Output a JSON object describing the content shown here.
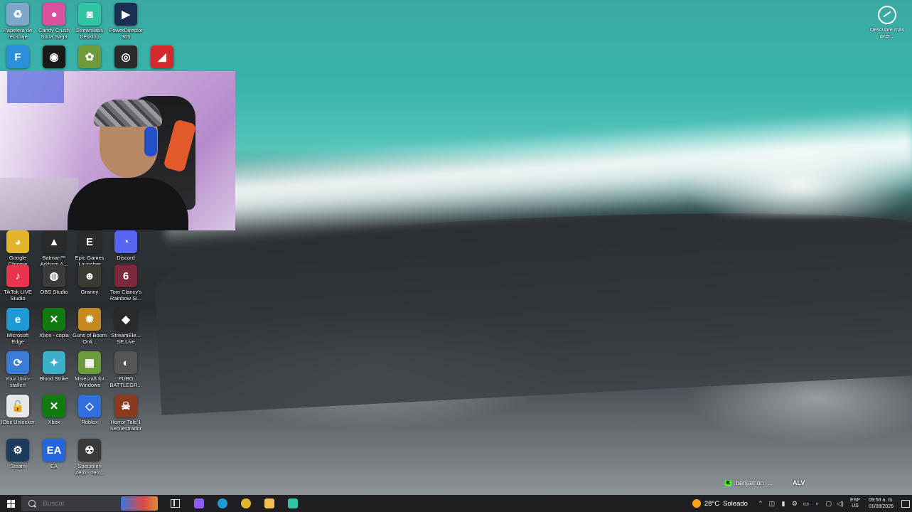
{
  "desktop": {
    "icons": [
      {
        "label": "Papelera de reciclaje",
        "icon": "recycle-bin-icon",
        "color": "#7fa7c9",
        "glyph": "♻"
      },
      {
        "label": "Candy Crush Soda Saga",
        "icon": "candy-crush-icon",
        "color": "#d9539c",
        "glyph": "●"
      },
      {
        "label": "Streamlabs Desktop",
        "icon": "streamlabs-icon",
        "color": "#31c3a2",
        "glyph": "◙"
      },
      {
        "label": "PowerDirector 365",
        "icon": "powerdirector-icon",
        "color": "#1b2f55",
        "glyph": "▶"
      },
      {
        "label": "",
        "icon": "app-icon-blue",
        "color": "#2c8fd9",
        "glyph": "F"
      },
      {
        "label": "",
        "icon": "app-icon-eye",
        "color": "#1a1a1a",
        "glyph": "◉"
      },
      {
        "label": "",
        "icon": "app-icon-flower",
        "color": "#6f9a3c",
        "glyph": "✿"
      },
      {
        "label": "",
        "icon": "app-icon-spiral",
        "color": "#2a2a2a",
        "glyph": "◎"
      },
      {
        "label": "",
        "icon": "amd-icon",
        "color": "#d42a2a",
        "glyph": "◢"
      },
      {
        "label": "Google Chrome",
        "icon": "chrome-icon",
        "color": "#e4b42a",
        "glyph": "◕"
      },
      {
        "label": "Batman™ Arkham A...",
        "icon": "batman-icon",
        "color": "#2b2b2b",
        "glyph": "▲"
      },
      {
        "label": "Epic Games Launcher",
        "icon": "epic-games-icon",
        "color": "#2b2b2b",
        "glyph": "E"
      },
      {
        "label": "Discord",
        "icon": "discord-icon",
        "color": "#5865f2",
        "glyph": "◔"
      },
      {
        "label": "TikTok LIVE Studio",
        "icon": "tiktok-icon",
        "color": "#e8344f",
        "glyph": "♪"
      },
      {
        "label": "OBS Studio",
        "icon": "obs-icon",
        "color": "#3b3b3b",
        "glyph": "◍"
      },
      {
        "label": "Granny",
        "icon": "granny-icon",
        "color": "#3a3a30",
        "glyph": "☻"
      },
      {
        "label": "Tom Clancy's Rainbow Si...",
        "icon": "rainbow-six-icon",
        "color": "#7a2a3a",
        "glyph": "6"
      },
      {
        "label": "Microsoft Edge",
        "icon": "edge-icon",
        "color": "#1f9ad6",
        "glyph": "e"
      },
      {
        "label": "Xbox - copia",
        "icon": "xbox-icon",
        "color": "#107c10",
        "glyph": "✕"
      },
      {
        "label": "Guns of Boom Onli...",
        "icon": "guns-of-boom-icon",
        "color": "#c58a1e",
        "glyph": "✹"
      },
      {
        "label": "StreamEle... SE.Live",
        "icon": "streamelements-icon",
        "color": "#2a2a2a",
        "glyph": "◆"
      },
      {
        "label": "Your Unin-staller!",
        "icon": "uninstaller-icon",
        "color": "#3a7dd8",
        "glyph": "⟳"
      },
      {
        "label": "Blood Strike",
        "icon": "blood-strike-icon",
        "color": "#3bb0c9",
        "glyph": "✦"
      },
      {
        "label": "Minecraft for Windows",
        "icon": "minecraft-icon",
        "color": "#6b9b3a",
        "glyph": "▦"
      },
      {
        "label": "PUBG BATTLEGR...",
        "icon": "pubg-icon",
        "color": "#555555",
        "glyph": "◐"
      },
      {
        "label": "IObit Unlocker",
        "icon": "iobit-unlocker-icon",
        "color": "#e6e6e6",
        "glyph": "🔓"
      },
      {
        "label": "Xbox",
        "icon": "xbox-icon",
        "color": "#107c10",
        "glyph": "✕"
      },
      {
        "label": "Roblox",
        "icon": "roblox-icon",
        "color": "#2f6fe0",
        "glyph": "◇"
      },
      {
        "label": "Horror Tale 1 Secuestrador",
        "icon": "horror-tale-icon",
        "color": "#8a3a1e",
        "glyph": "☠"
      },
      {
        "label": "Steam",
        "icon": "steam-icon",
        "color": "#1b3a5c",
        "glyph": "⚙"
      },
      {
        "label": "EA",
        "icon": "ea-icon",
        "color": "#2566d8",
        "glyph": "EA"
      },
      {
        "label": "Specimen Zero - Terr...",
        "icon": "specimen-zero-icon",
        "color": "#3a3a3a",
        "glyph": "☢"
      }
    ]
  },
  "widget": {
    "label": "Descubre más acer..."
  },
  "watermark": {
    "username": "benjamon_...",
    "tag": "ALV"
  },
  "taskbar": {
    "search_placeholder": "Buscar",
    "pinned": [
      {
        "name": "taskbar-copilot",
        "icon": "copilot-icon",
        "color": "#8b5cf6"
      },
      {
        "name": "taskbar-edge",
        "icon": "edge-icon",
        "color": "#1f9ad6"
      },
      {
        "name": "taskbar-chrome",
        "icon": "chrome-icon",
        "color": "#e4b42a"
      },
      {
        "name": "taskbar-file-explorer",
        "icon": "folder-icon",
        "color": "#f2c14e"
      },
      {
        "name": "taskbar-streamlabs",
        "icon": "streamlabs-icon",
        "color": "#31c3a2"
      }
    ],
    "weather": {
      "temp": "28°C",
      "condition": "Soleado"
    },
    "language": {
      "line1": "ESP",
      "line2": "US"
    },
    "clock": {
      "time": "09:58 a. m.",
      "date": "01/08/2026"
    }
  }
}
